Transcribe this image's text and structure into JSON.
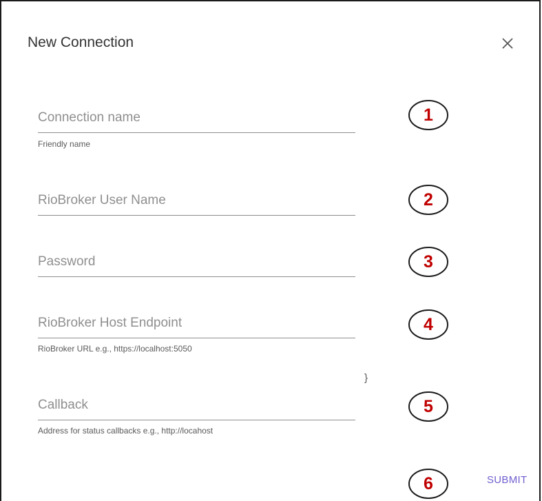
{
  "dialog": {
    "title": "New Connection",
    "close_icon": "close-icon"
  },
  "fields": [
    {
      "placeholder": "Connection name",
      "value": "",
      "helper": "Friendly name",
      "badge": "1"
    },
    {
      "placeholder": "RioBroker User Name",
      "value": "",
      "helper": "",
      "badge": "2"
    },
    {
      "placeholder": "Password",
      "value": "",
      "helper": "",
      "badge": "3"
    },
    {
      "placeholder": "RioBroker Host Endpoint",
      "value": "",
      "helper": "RioBroker URL e.g., https://localhost:5050",
      "badge": "4"
    },
    {
      "placeholder": "Callback",
      "value": "",
      "helper": "Address for status callbacks e.g., http://locahost",
      "badge": "5"
    }
  ],
  "stray_text": "}",
  "actions": {
    "submit_label": "SUBMIT",
    "submit_badge": "6",
    "accent_color": "#6f5fcf"
  },
  "badge_color": "#c00000"
}
